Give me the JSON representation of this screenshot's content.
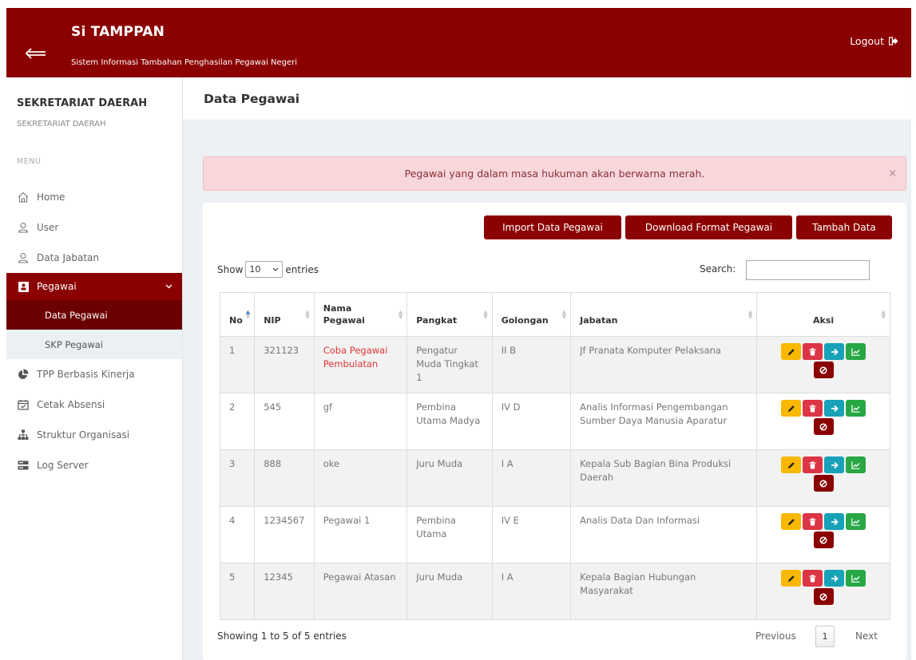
{
  "header": {
    "title": "Si TAMPPAN",
    "subtitle": "Sistem Informasi Tambahan Penghasilan Pegawai Negeri",
    "logout_label": "Logout"
  },
  "sidebar": {
    "org_name": "SEKRETARIAT DAERAH",
    "org_sub": "SEKRETARIAT DAERAH",
    "menu_label": "MENU",
    "items": [
      {
        "label": "Home",
        "icon": "home-icon"
      },
      {
        "label": "User",
        "icon": "user-icon"
      },
      {
        "label": "Data Jabatan",
        "icon": "user-icon"
      },
      {
        "label": "Pegawai",
        "icon": "id-card-icon"
      },
      {
        "label": "Data Pegawai"
      },
      {
        "label": "SKP Pegawai"
      },
      {
        "label": "TPP Berbasis Kinerja",
        "icon": "pie-chart-icon"
      },
      {
        "label": "Cetak Absensi",
        "icon": "calendar-icon"
      },
      {
        "label": "Struktur Organisasi",
        "icon": "sitemap-icon"
      },
      {
        "label": "Log Server",
        "icon": "server-icon"
      }
    ]
  },
  "page": {
    "title": "Data Pegawai",
    "alert": "Pegawai yang dalam masa hukuman akan berwarna merah.",
    "alert_close": "×"
  },
  "toolbar": {
    "import_label": "Import Data Pegawai",
    "download_label": "Download Format Pegawai",
    "add_label": "Tambah Data"
  },
  "table_controls": {
    "show_label": "Show",
    "entries_value": "10",
    "entries_label": "entries",
    "search_label": "Search:"
  },
  "table": {
    "headers": [
      "No",
      "NIP",
      "Nama Pegawai",
      "Pangkat",
      "Golongan",
      "Jabatan",
      "Aksi"
    ],
    "rows": [
      {
        "no": "1",
        "nip": "321123",
        "nama": "Coba Pegawai Pembulatan",
        "pangkat": "Pengatur Muda Tingkat 1",
        "golongan": "II B",
        "jabatan": "Jf Pranata Komputer Pelaksana",
        "hukuman": true
      },
      {
        "no": "2",
        "nip": "545",
        "nama": "gf",
        "pangkat": "Pembina Utama Madya",
        "golongan": "IV D",
        "jabatan": "Analis Informasi Pengembangan Sumber Daya Manusia Aparatur",
        "hukuman": false
      },
      {
        "no": "3",
        "nip": "888",
        "nama": "oke",
        "pangkat": "Juru Muda",
        "golongan": "I A",
        "jabatan": "Kepala Sub Bagian Bina Produksi Daerah",
        "hukuman": false
      },
      {
        "no": "4",
        "nip": "1234567",
        "nama": "Pegawai 1",
        "pangkat": "Pembina Utama",
        "golongan": "IV E",
        "jabatan": "Analis Data Dan Informasi",
        "hukuman": false
      },
      {
        "no": "5",
        "nip": "12345",
        "nama": "Pegawai Atasan",
        "pangkat": "Juru Muda",
        "golongan": "I A",
        "jabatan": "Kepala Bagian Hubungan Masyarakat",
        "hukuman": false
      }
    ]
  },
  "footer": {
    "showing": "Showing 1 to 5 of 5 entries",
    "previous": "Previous",
    "page": "1",
    "next": "Next"
  },
  "colors": {
    "brand": "#8b0000",
    "edit": "#f8b800",
    "delete": "#dc3545",
    "go": "#17a2b8",
    "chart": "#28a745",
    "red_text": "#e03535"
  }
}
